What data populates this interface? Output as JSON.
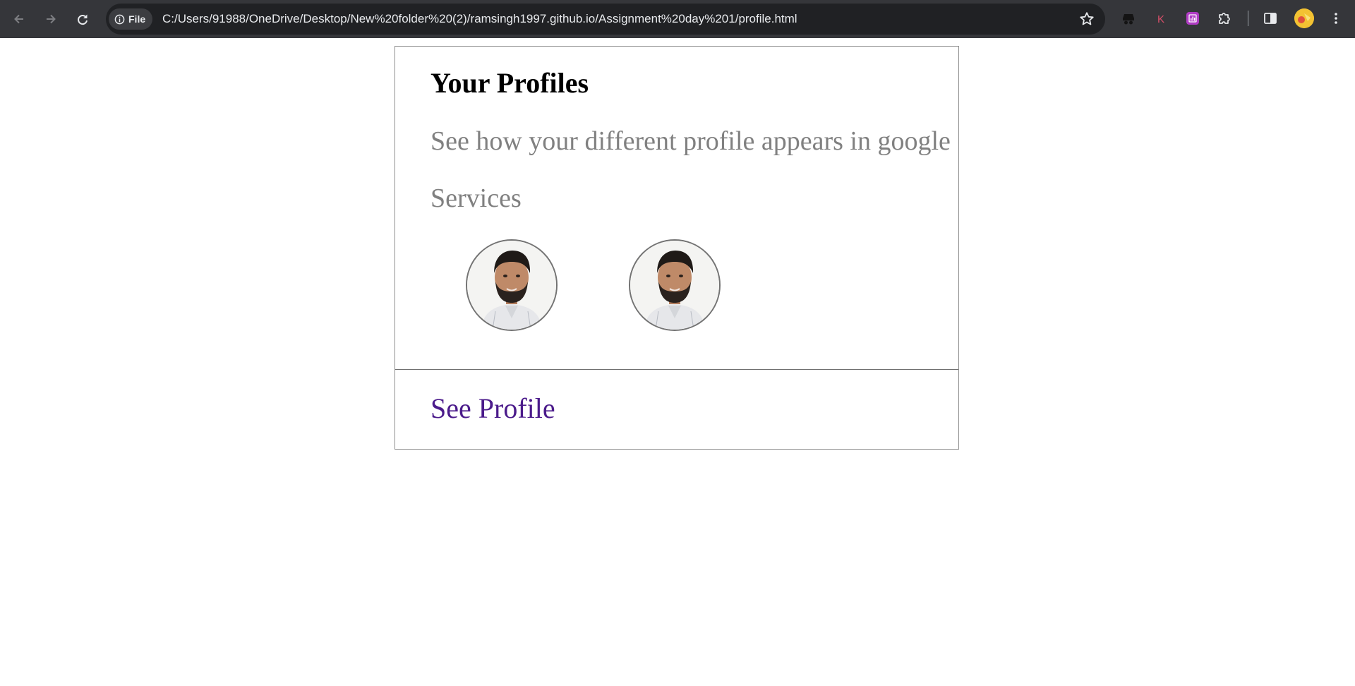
{
  "browser": {
    "site_chip_label": "File",
    "url": "C:/Users/91988/OneDrive/Desktop/New%20folder%20(2)/ramsingh1997.github.io/Assignment%20day%201/profile.html",
    "icons": [
      "back-arrow-icon",
      "forward-arrow-icon",
      "reload-icon",
      "info-icon",
      "star-icon",
      "incognito-extension-icon",
      "k-extension-icon",
      "chart-extension-icon",
      "puzzle-extensions-icon",
      "side-panel-icon",
      "profile-avatar",
      "kebab-menu-icon"
    ],
    "colors": {
      "toolbar": "#35363a",
      "omnibox": "#202124",
      "text": "#e8eaed"
    }
  },
  "card": {
    "title": "Your Profiles",
    "description": "See how your different profile appears in google Services",
    "avatars": [
      "profile-photo",
      "profile-photo"
    ],
    "link_label": "See Profile",
    "colors": {
      "description": "#808080",
      "link": "#4b1b8b",
      "border": "#8e8e8e"
    }
  }
}
